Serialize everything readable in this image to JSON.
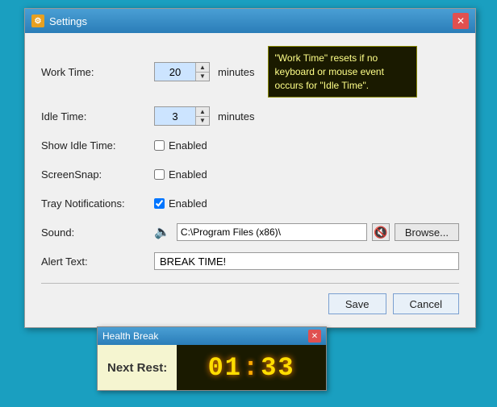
{
  "titleBar": {
    "title": "Settings",
    "icon": "⚙",
    "closeLabel": "✕"
  },
  "form": {
    "workTime": {
      "label": "Work Time:",
      "value": "20",
      "unit": "minutes"
    },
    "idleTime": {
      "label": "Idle Time:",
      "value": "3",
      "unit": "minutes"
    },
    "showIdleTime": {
      "label": "Show Idle Time:",
      "checkboxLabel": "Enabled",
      "checked": false
    },
    "screenSnap": {
      "label": "ScreenSnap:",
      "checkboxLabel": "Enabled",
      "checked": false
    },
    "trayNotifications": {
      "label": "Tray Notifications:",
      "checkboxLabel": "Enabled",
      "checked": true
    },
    "sound": {
      "label": "Sound:",
      "path": "C:\\Program Files (x86)\\",
      "browseBtnLabel": "Browse..."
    },
    "alertText": {
      "label": "Alert Text:",
      "value": "BREAK TIME!"
    }
  },
  "tooltip": {
    "text": "\"Work Time\" resets if no keyboard or mouse event occurs for \"Idle Time\"."
  },
  "buttons": {
    "save": "Save",
    "cancel": "Cancel"
  },
  "healthBreak": {
    "title": "Health Break",
    "nextRestLabel": "Next Rest:",
    "closeLabel": "✕",
    "timeDisplay": "01:33"
  }
}
